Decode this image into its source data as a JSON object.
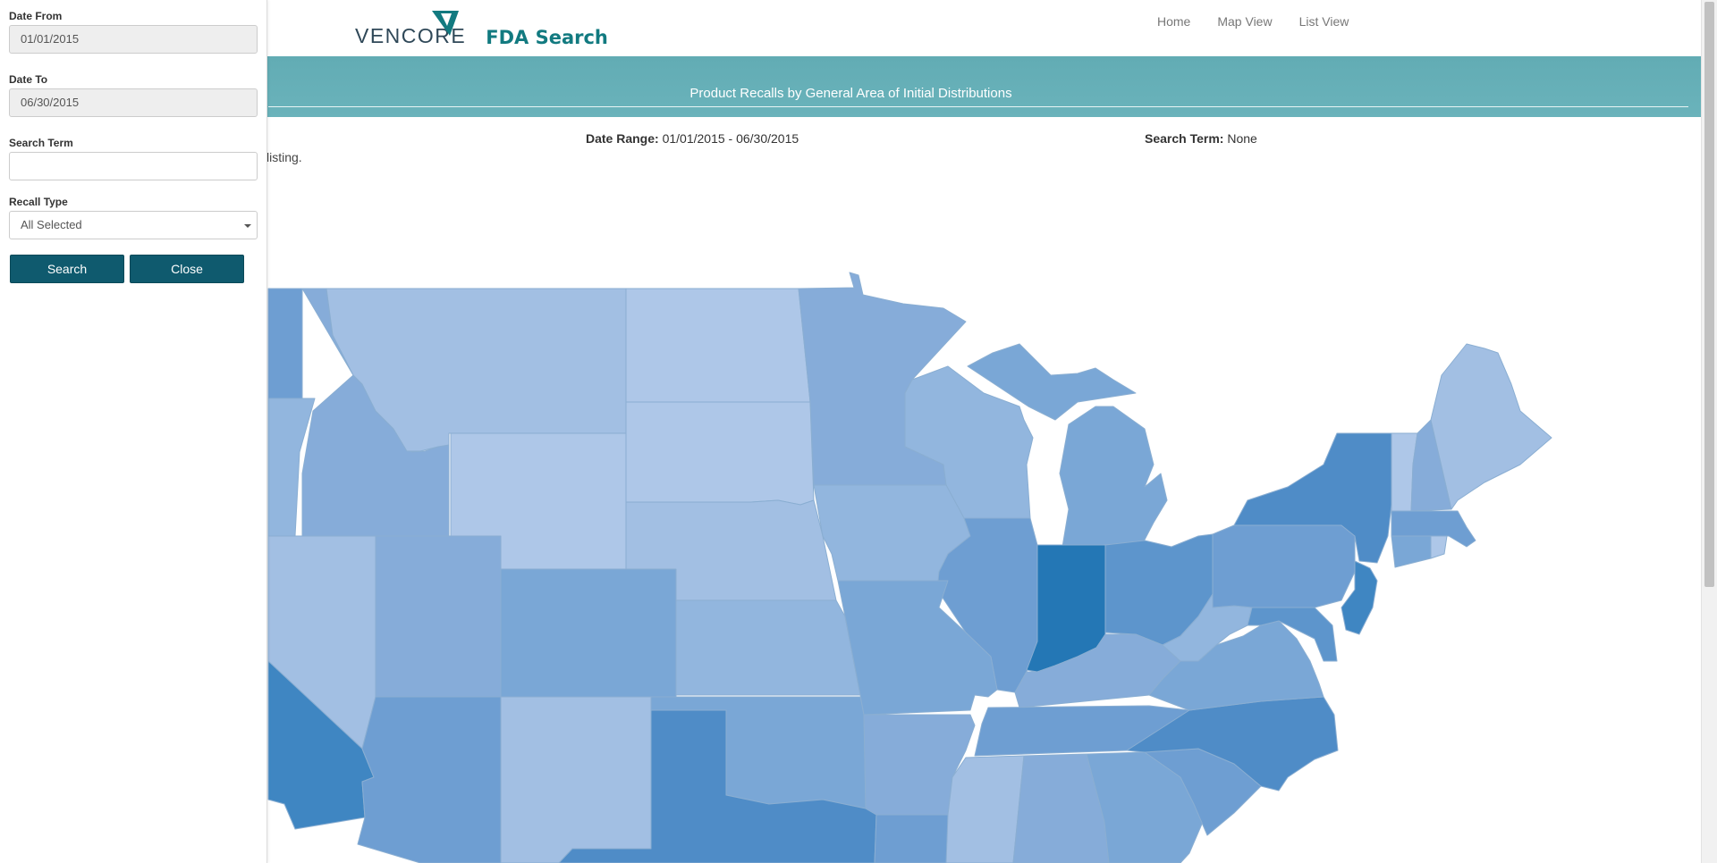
{
  "header": {
    "logo_text": "VENCORE",
    "app_title": "FDA Search",
    "nav": [
      "Home",
      "Map View",
      "List View"
    ]
  },
  "banner": {
    "title": "Product Recalls by General Area of Initial Distributions"
  },
  "summary": {
    "date_range_label": "Date Range:",
    "date_range_value": "01/01/2015 - 06/30/2015",
    "search_term_label": "Search Term:",
    "search_term_value": "None",
    "partial_text": "listing."
  },
  "sidebar": {
    "date_from_label": "Date From",
    "date_from_value": "01/01/2015",
    "date_to_label": "Date To",
    "date_to_value": "06/30/2015",
    "search_term_label": "Search Term",
    "search_term_value": "",
    "recall_type_label": "Recall Type",
    "recall_type_value": "All Selected",
    "search_button": "Search",
    "close_button": "Close"
  },
  "map": {
    "region": "United States choropleth (partially covered by sidebar)",
    "color_scale": [
      "#aec7e8",
      "#a2bfe3",
      "#92b6de",
      "#86acd9",
      "#7aa7d6",
      "#6e9ed2",
      "#5d95cc",
      "#4f8cc7",
      "#2477b5"
    ]
  }
}
